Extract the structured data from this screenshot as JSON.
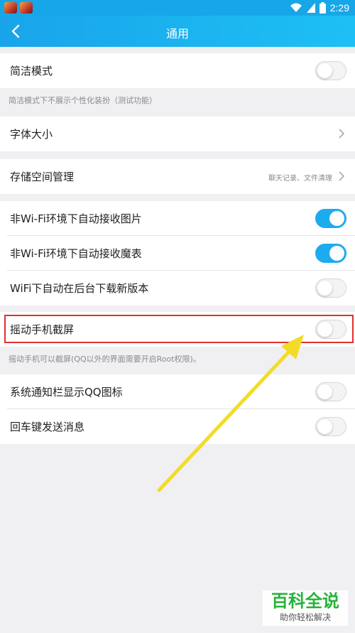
{
  "status_bar": {
    "time": "2:29",
    "icons": [
      "app-notification-icon",
      "app-notification-icon",
      "wifi-icon",
      "signal-icon",
      "battery-icon"
    ]
  },
  "nav": {
    "title": "通用",
    "back_icon": "back-arrow-icon"
  },
  "settings": {
    "simple_mode": {
      "label": "简洁模式",
      "on": false,
      "hint": "简洁模式下不展示个性化装扮（测试功能）"
    },
    "font_size": {
      "label": "字体大小"
    },
    "storage": {
      "label": "存储空间管理",
      "sub": "聊天记录、文件清理"
    },
    "auto_recv_images": {
      "label": "非Wi-Fi环境下自动接收图片",
      "on": true
    },
    "auto_recv_magic": {
      "label": "非Wi-Fi环境下自动接收魔表",
      "on": true
    },
    "wifi_auto_download": {
      "label": "WiFi下自动在后台下载新版本",
      "on": false
    },
    "shake_screenshot": {
      "label": "摇动手机截屏",
      "on": false,
      "hint": "摇动手机可以截屏(QQ以外的界面需要开启Root权限)。"
    },
    "notif_qq_icon": {
      "label": "系统通知栏显示QQ图标",
      "on": false
    },
    "enter_send": {
      "label": "回车键发送消息",
      "on": false
    }
  },
  "annotation": {
    "highlight_color": "#e0302d",
    "arrow_color": "#f2dc28"
  },
  "watermark": {
    "title": "百科全说",
    "subtitle": "助你轻松解决"
  },
  "colors": {
    "accent": "#1dabf0",
    "background": "#f0f0f3"
  }
}
